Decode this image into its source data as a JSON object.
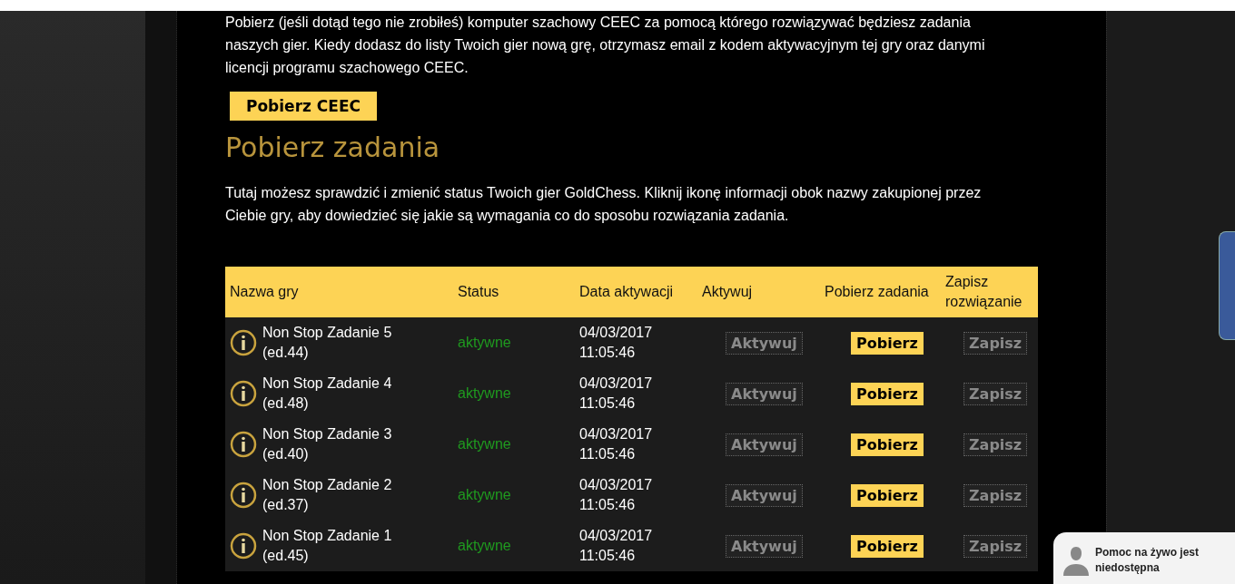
{
  "intro": "Pobierz (jeśli dotąd tego nie zrobiłeś) komputer szachowy CEEC za pomocą którego rozwiązywać będziesz zadania naszych gier. Kiedy dodasz do listy Twoich gier nową grę, otrzymasz email z kodem aktywacyjnym tej gry oraz danymi licencji programu szachowego CEEC.",
  "download_button": "Pobierz CEEC",
  "heading": "Pobierz zadania",
  "description": "Tutaj możesz sprawdzić i zmienić status Twoich gier GoldChess. Kliknij ikonę informacji obok nazwy zakupionej przez Ciebie gry, aby dowiedzieć się jakie są wymagania co do sposobu rozwiązania zadania.",
  "table": {
    "columns": [
      "Nazwa gry",
      "Status",
      "Data aktywacji",
      "Aktywuj",
      "Pobierz zadania",
      "Zapisz rozwiązanie"
    ],
    "rows": [
      {
        "name": "Non Stop Zadanie 5",
        "edition": "(ed.44)",
        "status": "aktywne",
        "date": "04/03/2017",
        "time": "11:05:46",
        "buttons": [
          {
            "label": "Aktywuj",
            "disabled": true
          },
          {
            "label": "Pobierz",
            "disabled": false
          },
          {
            "label": "Zapisz",
            "disabled": true
          }
        ]
      },
      {
        "name": "Non Stop Zadanie 4",
        "edition": "(ed.48)",
        "status": "aktywne",
        "date": "04/03/2017",
        "time": "11:05:46",
        "buttons": [
          {
            "label": "Aktywuj",
            "disabled": true
          },
          {
            "label": "Pobierz",
            "disabled": false
          },
          {
            "label": "Zapisz",
            "disabled": true
          }
        ]
      },
      {
        "name": "Non Stop Zadanie 3",
        "edition": "(ed.40)",
        "status": "aktywne",
        "date": "04/03/2017",
        "time": "11:05:46",
        "buttons": [
          {
            "label": "Aktywuj",
            "disabled": true
          },
          {
            "label": "Pobierz",
            "disabled": false
          },
          {
            "label": "Zapisz",
            "disabled": true
          }
        ]
      },
      {
        "name": "Non Stop Zadanie 2",
        "edition": "(ed.37)",
        "status": "aktywne",
        "date": "04/03/2017",
        "time": "11:05:46",
        "buttons": [
          {
            "label": "Aktywuj",
            "disabled": true
          },
          {
            "label": "Pobierz",
            "disabled": false
          },
          {
            "label": "Zapisz",
            "disabled": true
          }
        ]
      },
      {
        "name": "Non Stop Zadanie 1",
        "edition": "(ed.45)",
        "status": "aktywne",
        "date": "04/03/2017",
        "time": "11:05:46",
        "buttons": [
          {
            "label": "Aktywuj",
            "disabled": true
          },
          {
            "label": "Pobierz",
            "disabled": false
          },
          {
            "label": "Zapisz",
            "disabled": true
          }
        ]
      }
    ]
  },
  "live_chat": {
    "text": "Pomoc na żywo jest niedostępna"
  }
}
